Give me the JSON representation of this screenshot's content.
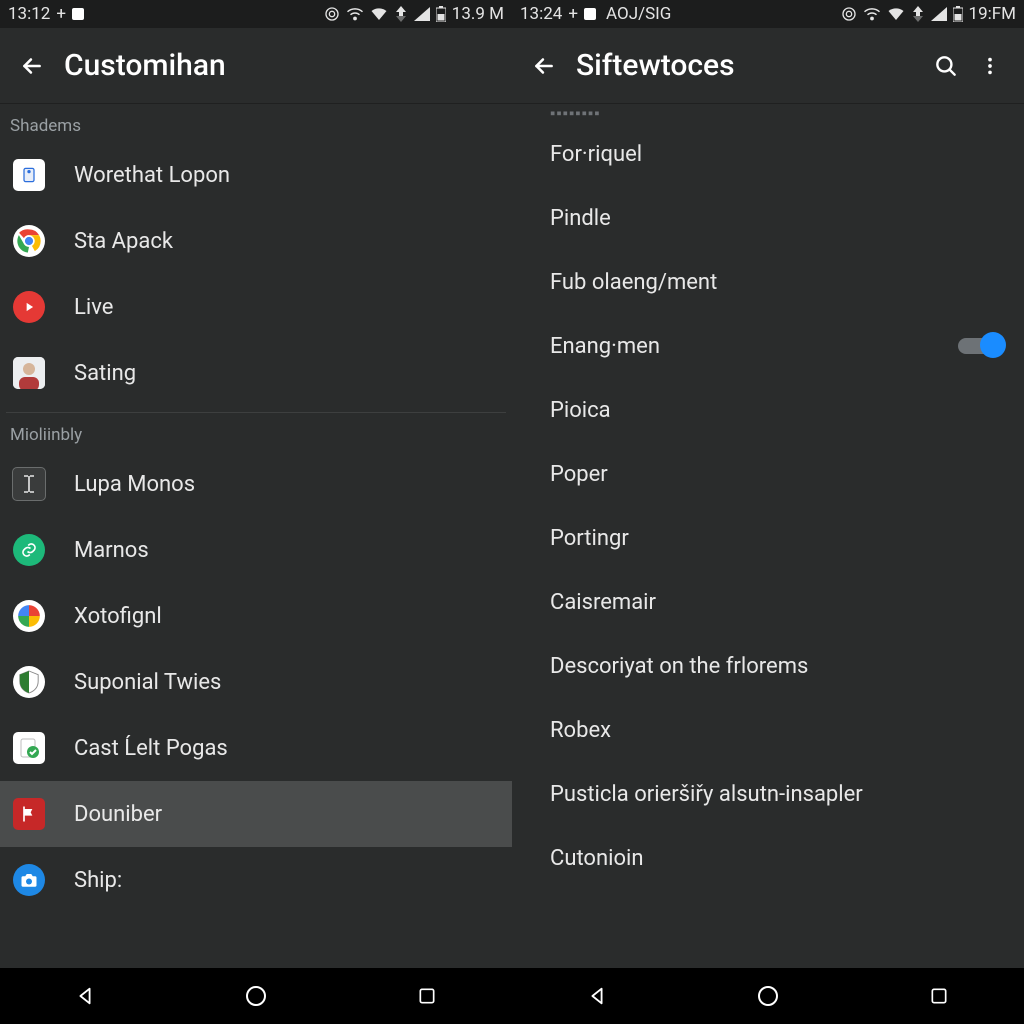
{
  "left": {
    "status": {
      "clock": "13:12",
      "plus": "+",
      "right_text": "13.9 M"
    },
    "appbar": {
      "title": "Customihan"
    },
    "sections": [
      {
        "header": "Shadems",
        "items": [
          {
            "name": "worethat-lopon",
            "label": "Worethat Lopon",
            "icon": "clipboard-icon",
            "icon_bg": "#ffffff",
            "icon_fg": "#2b6edc",
            "shape": "square"
          },
          {
            "name": "sta-apack",
            "label": "Sta Apack",
            "icon": "chrome-icon",
            "icon_bg": "#ffffff",
            "icon_fg": "#4285f4",
            "shape": "round"
          },
          {
            "name": "live",
            "label": "Live",
            "icon": "play-icon",
            "icon_bg": "#e53935",
            "icon_fg": "#ffffff",
            "shape": "round"
          },
          {
            "name": "sating",
            "label": "Sating",
            "icon": "avatar-icon",
            "icon_bg": "#ffffff",
            "icon_fg": "#b04433",
            "shape": "square"
          }
        ]
      },
      {
        "header": "Mioliinbly",
        "items": [
          {
            "name": "lupa-monos",
            "label": "Lupa Monos",
            "icon": "text-cursor-icon",
            "icon_bg": "#3a3c3c",
            "icon_fg": "#ffffff",
            "shape": "square"
          },
          {
            "name": "marnos",
            "label": "Marnos",
            "icon": "link-icon",
            "icon_bg": "#1db97a",
            "icon_fg": "#ffffff",
            "shape": "round"
          },
          {
            "name": "xotofignl",
            "label": "Xotofignl",
            "icon": "pie-icon",
            "icon_bg": "#ffffff",
            "icon_fg": "#4285f4",
            "shape": "round"
          },
          {
            "name": "suponial-twies",
            "label": "Suponial Twies",
            "icon": "shield-icon",
            "icon_bg": "#ffffff",
            "icon_fg": "#2e7d32",
            "shape": "round"
          },
          {
            "name": "cast-lelt-pogas",
            "label": "Cast Ĺelt Pogas",
            "icon": "check-doc-icon",
            "icon_bg": "#ffffff",
            "icon_fg": "#fb8c00",
            "shape": "square"
          },
          {
            "name": "douniber",
            "label": "Douniber",
            "icon": "flag-icon",
            "icon_bg": "#c62828",
            "icon_fg": "#ffffff",
            "shape": "square",
            "selected": true
          },
          {
            "name": "ship",
            "label": "Ship:",
            "icon": "camera-icon",
            "icon_bg": "#1e88e5",
            "icon_fg": "#ffffff",
            "shape": "round"
          }
        ]
      }
    ]
  },
  "right": {
    "status": {
      "clock": "13:24",
      "plus": "+",
      "carrier": "AOJ/SIG",
      "right_text": "19:FM"
    },
    "appbar": {
      "title": "Siftewtoces"
    },
    "cutoff_hint": "",
    "items": [
      {
        "name": "forriquel",
        "label": "For·riquel"
      },
      {
        "name": "pindle",
        "label": "Pindle"
      },
      {
        "name": "fub-olaeng",
        "label": "Fub olaeng/ment"
      },
      {
        "name": "enang-men",
        "label": "Enang·men",
        "toggle": true,
        "toggle_on": true
      },
      {
        "name": "pioica",
        "label": "Pioica"
      },
      {
        "name": "poper",
        "label": "Poper"
      },
      {
        "name": "portingr",
        "label": "Portingr"
      },
      {
        "name": "caisremair",
        "label": "Caisremair"
      },
      {
        "name": "descoriyat",
        "label": "Descoriyat on the frlorems"
      },
      {
        "name": "robex",
        "label": "Robex"
      },
      {
        "name": "pusticla",
        "label": "Pusticla orieršiřy alsutn-insapler"
      },
      {
        "name": "cutonioin",
        "label": "Cutonioin"
      }
    ]
  },
  "colors": {
    "bg": "#2a2c2c",
    "bg_dark": "#1c1d1d",
    "text": "#e8e8e8",
    "text_muted": "#9aa0a4",
    "accent": "#1a8cff"
  }
}
